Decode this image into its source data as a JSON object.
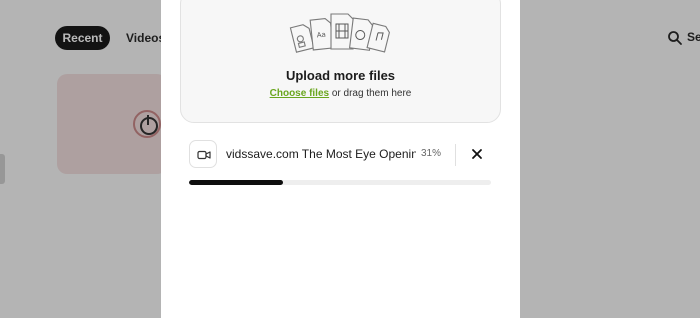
{
  "background": {
    "tabs": [
      "Recent",
      "Videos"
    ],
    "search_label": "Se"
  },
  "upload": {
    "title": "Upload more files",
    "choose_link": "Choose files",
    "drag_text": " or drag them here"
  },
  "file": {
    "name": "vidssave.com The Most Eye Openin...",
    "percent_label": "31%",
    "progress": 0.31,
    "type_icon": "video-icon"
  },
  "colors": {
    "accent_link": "#6aa61e",
    "progress_fill": "#0e0e0e",
    "primary_dark": "#1b1b1b"
  }
}
